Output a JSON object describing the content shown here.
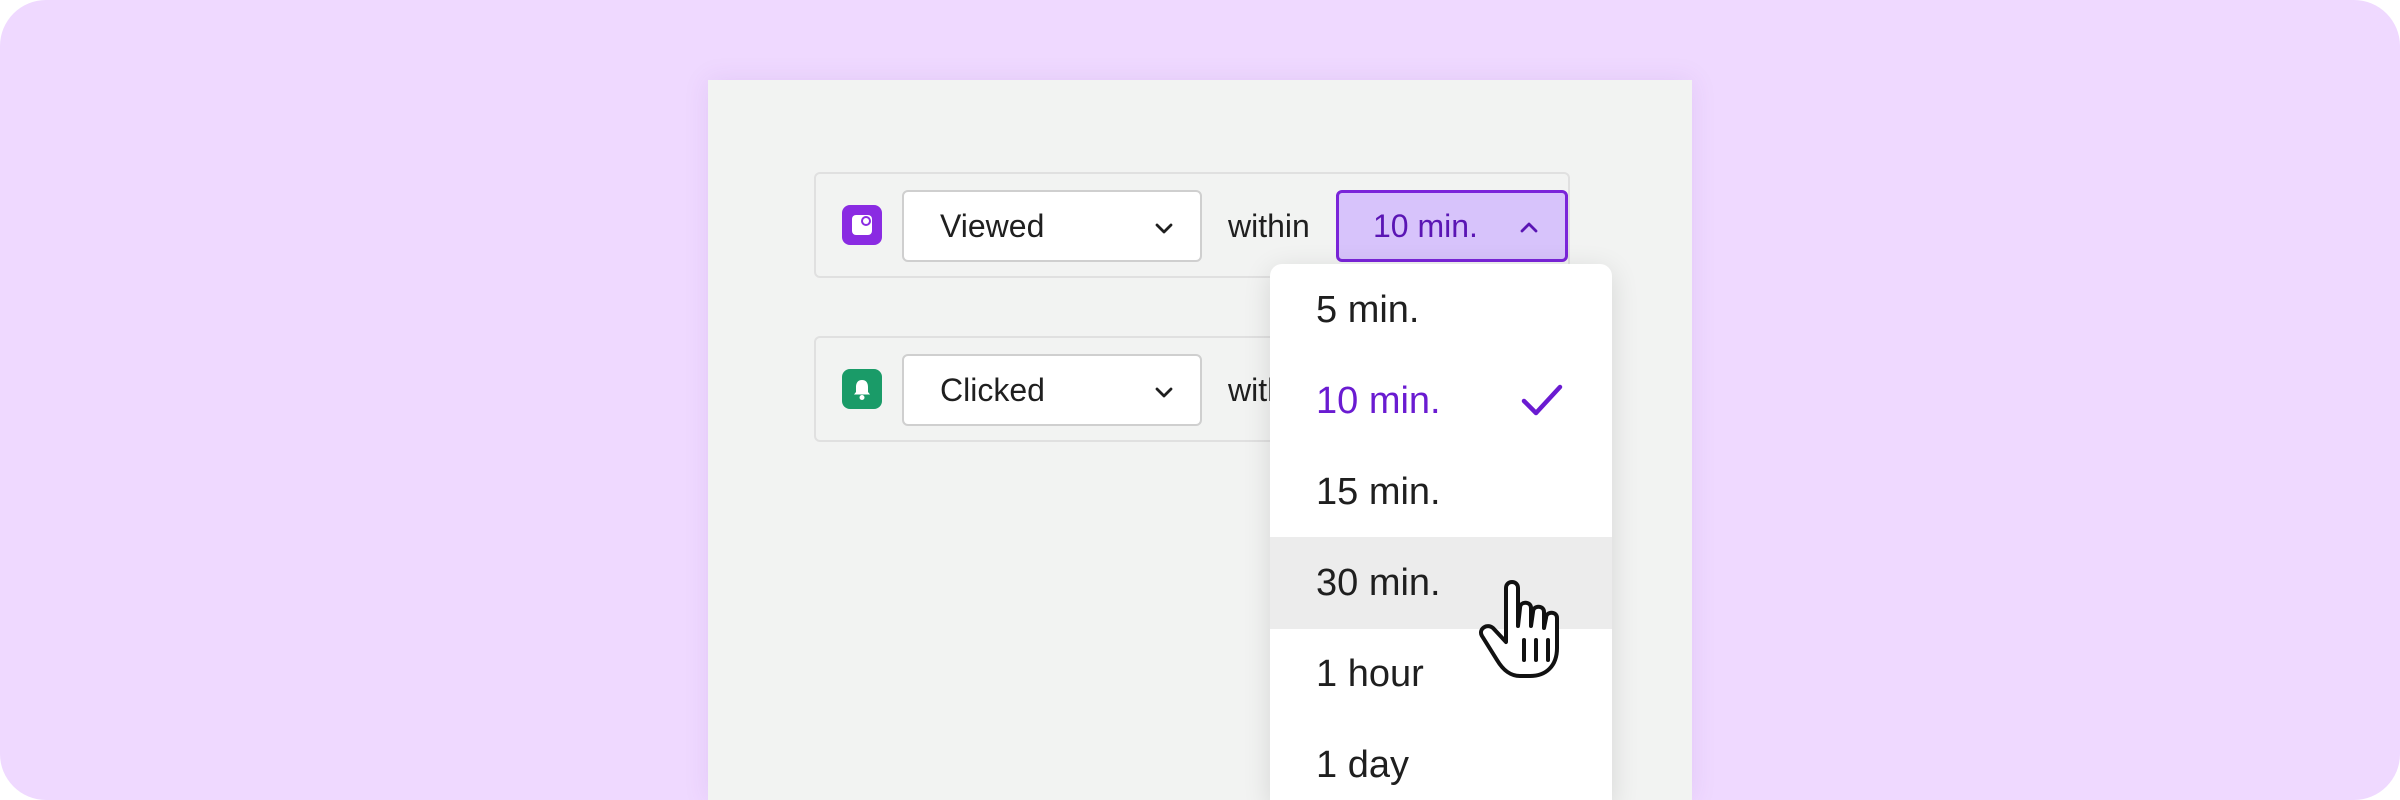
{
  "colors": {
    "background": "#efd9ff",
    "panel": "#f2f3f2",
    "accent": "#7a24d9",
    "viewed_icon_bg": "#8a2be2",
    "clicked_icon_bg": "#1a9b68"
  },
  "rows": [
    {
      "icon": "message-icon",
      "event": "Viewed",
      "connector": "within",
      "time": "10 min."
    },
    {
      "icon": "bell-icon",
      "event": "Clicked",
      "connector": "with"
    }
  ],
  "dropdown": {
    "options": [
      "5 min.",
      "10 min.",
      "15 min.",
      "30 min.",
      "1 hour",
      "1 day"
    ],
    "selected_index": 1,
    "hovered_index": 3
  }
}
